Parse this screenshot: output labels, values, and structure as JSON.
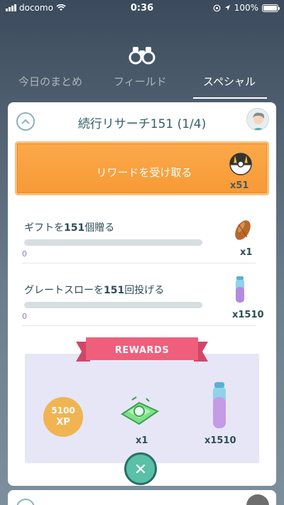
{
  "statusbar": {
    "carrier": "docomo",
    "time": "0:36",
    "battery": "100%"
  },
  "tabs": [
    {
      "label": "今日のまとめ"
    },
    {
      "label": "フィールド"
    },
    {
      "label": "スペシャル"
    }
  ],
  "research": {
    "title": "続行リサーチ151 (1/4)",
    "claim_label": "リワードを受け取る",
    "claim_reward": {
      "icon": "ultra-ball-icon",
      "count": "x51"
    },
    "tasks": [
      {
        "text_prefix": "ギフトを",
        "text_number": "151",
        "text_suffix": "個贈る",
        "progress": "0",
        "reward_icon": "pinap-berry-icon",
        "reward_count": "x1"
      },
      {
        "text_prefix": "グレートスローを",
        "text_number": "151",
        "text_suffix": "回投げる",
        "progress": "0",
        "reward_icon": "star-piece-icon",
        "reward_count": "x1510"
      }
    ],
    "rewards": {
      "banner": "REWARDS",
      "xp_value": "5100",
      "xp_unit": "XP",
      "item1": {
        "icon": "incubator-icon",
        "count": "x1"
      },
      "item2": {
        "icon": "star-piece-icon",
        "count": "x1510"
      }
    }
  },
  "colors": {
    "accent_orange": "#f79a36",
    "teal": "#5ac0a8",
    "ribbon": "#ef5f7c",
    "rewards_bg": "#e6e6f7"
  }
}
